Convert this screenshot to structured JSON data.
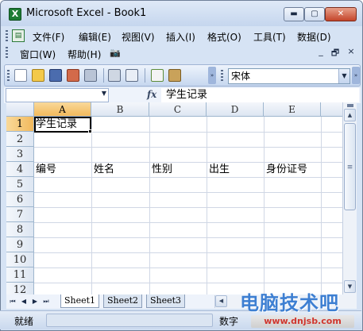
{
  "window": {
    "title": "Microsoft Excel - Book1",
    "app_icon_glyph": "X",
    "min_glyph": "▬",
    "max_glyph": "▢",
    "close_glyph": "✕"
  },
  "menubar": {
    "items": [
      "文件(F)",
      "编辑(E)",
      "视图(V)",
      "插入(I)",
      "格式(O)",
      "工具(T)",
      "数据(D)"
    ],
    "items_row2": [
      "窗口(W)",
      "帮助(H)"
    ],
    "doc_minimize": "_",
    "doc_restore": "🗗",
    "doc_close": "×"
  },
  "toolbar": {
    "icons": [
      "new-file",
      "open-folder",
      "save",
      "permission",
      "print",
      "print-preview",
      "research",
      "spelling",
      "format-painter"
    ],
    "font_name": "宋体",
    "dropdown_glyph": "▼",
    "chevron_glyph": "»"
  },
  "formula_bar": {
    "name_box_value": "",
    "fx_label": "fx",
    "content": "学生记录"
  },
  "sheet": {
    "columns": [
      "A",
      "B",
      "C",
      "D",
      "E"
    ],
    "rows": [
      "1",
      "2",
      "3",
      "4",
      "5",
      "6",
      "7",
      "8",
      "9",
      "10",
      "11",
      "12"
    ],
    "active_cell": "A1",
    "cells": {
      "A1": "学生记录",
      "A4": "编号",
      "B4": "姓名",
      "C4": "性别",
      "D4": "出生",
      "E4": "身份证号"
    }
  },
  "tabs": {
    "nav": [
      "⏮",
      "◀",
      "▶",
      "⏭"
    ],
    "sheets": [
      "Sheet1",
      "Sheet2",
      "Sheet3"
    ],
    "active": "Sheet1"
  },
  "status": {
    "ready": "就绪",
    "num": "数字"
  },
  "watermark": {
    "text": "电脑技术吧",
    "url": "www.dnjsb.com"
  },
  "colors": {
    "title_bar": "#c5d6ee",
    "active_header": "#f2b95c",
    "gridline": "#d0d7e5",
    "watermark_blue": "#3d7fd2"
  }
}
